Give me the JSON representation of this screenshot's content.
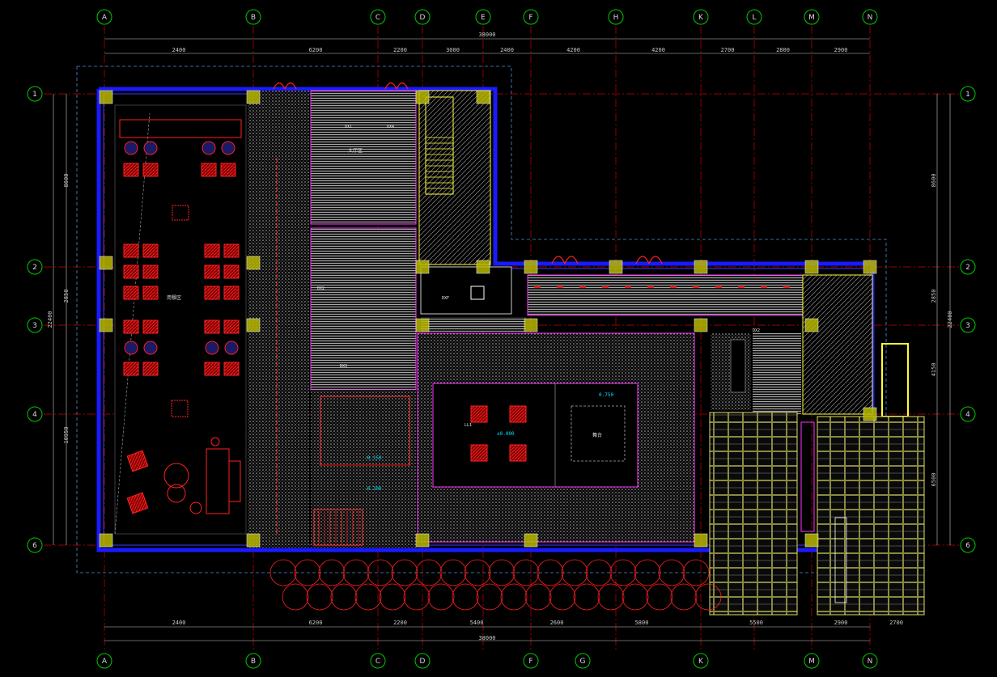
{
  "colors": {
    "background": "#000000",
    "grid_bubble": "#00cc00",
    "axis_line": "#cc0000",
    "wall": "#1a1aff",
    "column": "#b8b800",
    "dimension": "#c8c8c8",
    "hatch": "#9a9a9a",
    "stair": "#ffff33",
    "level": "#00e5ff",
    "furniture": "#ff2020",
    "magenta": "#ff33ff"
  },
  "axes_top": [
    "A",
    "B",
    "C",
    "D",
    "E",
    "F",
    "H",
    "K",
    "L",
    "M",
    "N"
  ],
  "axes_bottom": [
    "A",
    "B",
    "C",
    "D",
    "F",
    "G",
    "K",
    "M",
    "N"
  ],
  "axes_rows": [
    "1",
    "2",
    "3",
    "4",
    "6"
  ],
  "dims": {
    "top_total": "38000",
    "top_segments": [
      "2400",
      "6200",
      "2200",
      "3000",
      "2400",
      "4200",
      "4200",
      "2700",
      "2800",
      "2900"
    ],
    "bottom_total": "38000",
    "bottom_segments": [
      "2400",
      "6200",
      "2200",
      "5400",
      "2600",
      "5800",
      "5500",
      "2900",
      "2700"
    ],
    "left_total": "22400",
    "left_segments": [
      "8600",
      "2850",
      "10950"
    ],
    "right_total": "22400",
    "right_segments": [
      "8600",
      "2850",
      "4150",
      "6500"
    ]
  },
  "labels": {
    "seating_area": "用餐区",
    "hall": "大厅区",
    "stage_area": "舞台",
    "level_0": "±0.000",
    "level_1": "0.750",
    "level_2": "-0.150",
    "level_3": "-0.300",
    "tags": [
      "DX1",
      "DX2",
      "DX3",
      "DX4",
      "LL1",
      "DXF",
      "DX2"
    ]
  }
}
